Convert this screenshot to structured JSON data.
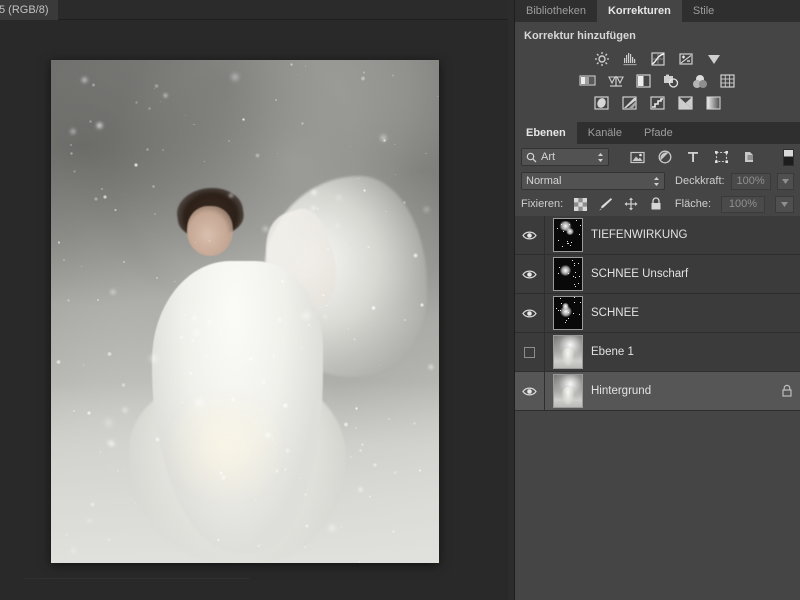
{
  "document": {
    "tab_label": "5 (RGB/8)"
  },
  "dock": {
    "top_panel": {
      "tabs": [
        {
          "label": "Bibliotheken",
          "active": false
        },
        {
          "label": "Korrekturen",
          "active": true
        },
        {
          "label": "Stile",
          "active": false
        }
      ],
      "title": "Korrektur hinzufügen",
      "icon_rows": [
        [
          "brightness-contrast-icon",
          "levels-histogram-icon",
          "curves-icon",
          "exposure-icon",
          "vibrance-triangle-icon"
        ],
        [
          "levels-gradient-icon",
          "color-balance-scale-icon",
          "black-white-icon",
          "photo-filter-icon",
          "channel-mixer-circles-icon",
          "color-lookup-grid-icon"
        ],
        [
          "invert-icon",
          "posterize-icon",
          "threshold-steps-icon",
          "selective-color-icon",
          "gradient-map-icon"
        ]
      ]
    },
    "layers_panel": {
      "tabs": [
        {
          "label": "Ebenen",
          "active": true
        },
        {
          "label": "Kanäle",
          "active": false
        },
        {
          "label": "Pfade",
          "active": false
        }
      ],
      "filter": {
        "kind_label": "Art",
        "search_icon": "search-icon",
        "type_filter_icons": [
          "pixel-layer-icon",
          "adjustment-layer-icon",
          "type-layer-icon",
          "shape-layer-icon",
          "smart-object-icon"
        ],
        "toggle_icon": "filter-toggle-switch"
      },
      "blend": {
        "mode": "Normal",
        "opacity_label": "Deckkraft:",
        "opacity_value": "100%"
      },
      "lock": {
        "label": "Fixieren:",
        "icons": [
          "lock-transparency-icon",
          "lock-image-icon",
          "lock-position-icon",
          "lock-all-icon"
        ],
        "fill_label": "Fläche:",
        "fill_value": "100%"
      },
      "layers": [
        {
          "name": "TIEFENWIRKUNG",
          "visible": true,
          "selected": false,
          "locked": false,
          "thumb": "snow"
        },
        {
          "name": "SCHNEE Unscharf",
          "visible": true,
          "selected": false,
          "locked": false,
          "thumb": "snow"
        },
        {
          "name": "SCHNEE",
          "visible": true,
          "selected": false,
          "locked": false,
          "thumb": "snow"
        },
        {
          "name": "Ebene 1",
          "visible": false,
          "selected": false,
          "locked": false,
          "thumb": "photo"
        },
        {
          "name": "Hintergrund",
          "visible": true,
          "selected": true,
          "locked": true,
          "thumb": "photo"
        }
      ]
    }
  },
  "colors": {
    "panel_bg": "#454545",
    "panel_tab_bg": "#2f2f2f",
    "layer_list_bg": "#3b3b3b",
    "layer_selected_bg": "#565656",
    "canvas_bg": "#292929",
    "text": "#e2e2e2",
    "text_dim": "#9d9d9d"
  }
}
